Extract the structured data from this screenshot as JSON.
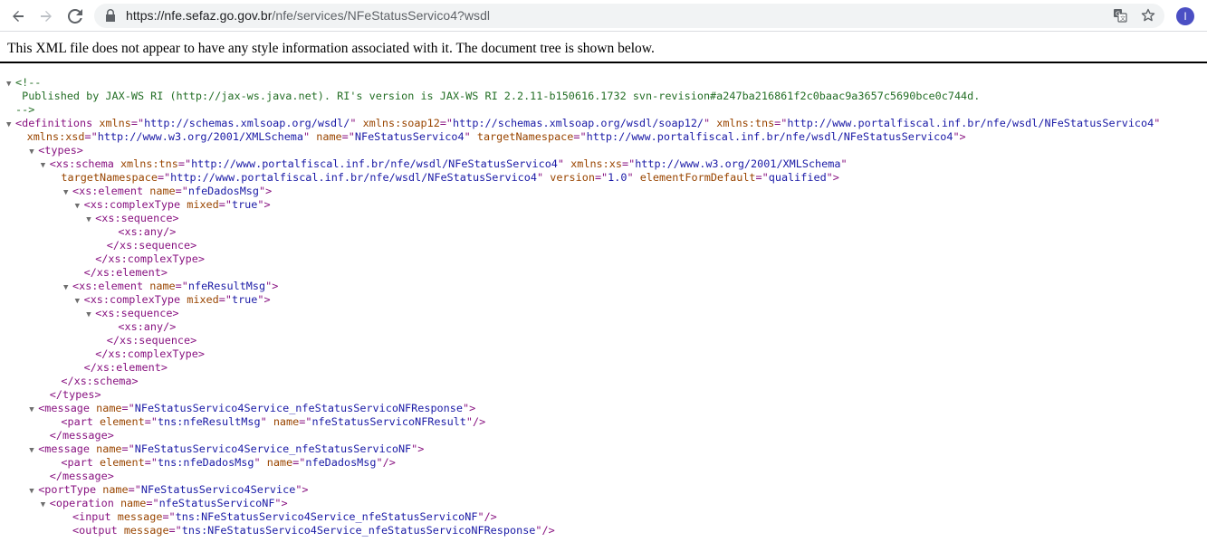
{
  "browser": {
    "url_host": "https://nfe.sefaz.go.gov.br",
    "url_path": "/nfe/services/NFeStatusServico4?wsdl",
    "avatar_letter": "I"
  },
  "info_message": "This XML file does not appear to have any style information associated with it. The document tree is shown below.",
  "xml_lines": [
    {
      "indent": 0,
      "arrow": "▼",
      "parts": [
        [
          "cm",
          "<!--"
        ]
      ]
    },
    {
      "indent": 0,
      "arrow": "",
      "parts": [
        [
          "cm",
          "    Published by JAX-WS RI (http://jax-ws.java.net). RI's version is JAX-WS RI 2.2.11-b150616.1732 svn-revision#a247ba216861f2c0baac9a3657c5690bce0c744d."
        ]
      ]
    },
    {
      "indent": 0,
      "arrow": "",
      "parts": [
        [
          "cm",
          "-->"
        ]
      ]
    },
    {
      "indent": 0,
      "arrow": "▼",
      "parts": [
        [
          "tag",
          "<definitions "
        ],
        [
          "an",
          "xmlns"
        ],
        [
          "tag",
          "=\""
        ],
        [
          "av",
          "http://schemas.xmlsoap.org/wsdl/"
        ],
        [
          "tag",
          "\" "
        ],
        [
          "an",
          "xmlns:soap12"
        ],
        [
          "tag",
          "=\""
        ],
        [
          "av",
          "http://schemas.xmlsoap.org/wsdl/soap12/"
        ],
        [
          "tag",
          "\" "
        ],
        [
          "an",
          "xmlns:tns"
        ],
        [
          "tag",
          "=\""
        ],
        [
          "av",
          "http://www.portalfiscal.inf.br/nfe/wsdl/NFeStatusServico4"
        ],
        [
          "tag",
          "\""
        ]
      ]
    },
    {
      "indent": 1,
      "arrow": "",
      "parts": [
        [
          "an",
          "xmlns:xsd"
        ],
        [
          "tag",
          "=\""
        ],
        [
          "av",
          "http://www.w3.org/2001/XMLSchema"
        ],
        [
          "tag",
          "\" "
        ],
        [
          "an",
          "name"
        ],
        [
          "tag",
          "=\""
        ],
        [
          "av",
          "NFeStatusServico4"
        ],
        [
          "tag",
          "\" "
        ],
        [
          "an",
          "targetNamespace"
        ],
        [
          "tag",
          "=\""
        ],
        [
          "av",
          "http://www.portalfiscal.inf.br/nfe/wsdl/NFeStatusServico4"
        ],
        [
          "tag",
          "\">"
        ]
      ]
    },
    {
      "indent": 2,
      "arrow": "▼",
      "parts": [
        [
          "tag",
          "<types>"
        ]
      ]
    },
    {
      "indent": 3,
      "arrow": "▼",
      "parts": [
        [
          "tag",
          "<xs:schema "
        ],
        [
          "an",
          "xmlns:tns"
        ],
        [
          "tag",
          "=\""
        ],
        [
          "av",
          "http://www.portalfiscal.inf.br/nfe/wsdl/NFeStatusServico4"
        ],
        [
          "tag",
          "\" "
        ],
        [
          "an",
          "xmlns:xs"
        ],
        [
          "tag",
          "=\""
        ],
        [
          "av",
          "http://www.w3.org/2001/XMLSchema"
        ],
        [
          "tag",
          "\""
        ]
      ]
    },
    {
      "indent": 4,
      "arrow": "",
      "parts": [
        [
          "an",
          "targetNamespace"
        ],
        [
          "tag",
          "=\""
        ],
        [
          "av",
          "http://www.portalfiscal.inf.br/nfe/wsdl/NFeStatusServico4"
        ],
        [
          "tag",
          "\" "
        ],
        [
          "an",
          "version"
        ],
        [
          "tag",
          "=\""
        ],
        [
          "av",
          "1.0"
        ],
        [
          "tag",
          "\" "
        ],
        [
          "an",
          "elementFormDefault"
        ],
        [
          "tag",
          "=\""
        ],
        [
          "av",
          "qualified"
        ],
        [
          "tag",
          "\">"
        ]
      ]
    },
    {
      "indent": 5,
      "arrow": "▼",
      "parts": [
        [
          "tag",
          "<xs:element "
        ],
        [
          "an",
          "name"
        ],
        [
          "tag",
          "=\""
        ],
        [
          "av",
          "nfeDadosMsg"
        ],
        [
          "tag",
          "\">"
        ]
      ]
    },
    {
      "indent": 6,
      "arrow": "▼",
      "parts": [
        [
          "tag",
          "<xs:complexType "
        ],
        [
          "an",
          "mixed"
        ],
        [
          "tag",
          "=\""
        ],
        [
          "av",
          "true"
        ],
        [
          "tag",
          "\">"
        ]
      ]
    },
    {
      "indent": 7,
      "arrow": "▼",
      "parts": [
        [
          "tag",
          "<xs:sequence>"
        ]
      ]
    },
    {
      "indent": 9,
      "arrow": "",
      "parts": [
        [
          "tag",
          "<xs:any/>"
        ]
      ]
    },
    {
      "indent": 8,
      "arrow": "",
      "parts": [
        [
          "tag",
          "</xs:sequence>"
        ]
      ]
    },
    {
      "indent": 7,
      "arrow": "",
      "parts": [
        [
          "tag",
          "</xs:complexType>"
        ]
      ]
    },
    {
      "indent": 6,
      "arrow": "",
      "parts": [
        [
          "tag",
          "</xs:element>"
        ]
      ]
    },
    {
      "indent": 5,
      "arrow": "▼",
      "parts": [
        [
          "tag",
          "<xs:element "
        ],
        [
          "an",
          "name"
        ],
        [
          "tag",
          "=\""
        ],
        [
          "av",
          "nfeResultMsg"
        ],
        [
          "tag",
          "\">"
        ]
      ]
    },
    {
      "indent": 6,
      "arrow": "▼",
      "parts": [
        [
          "tag",
          "<xs:complexType "
        ],
        [
          "an",
          "mixed"
        ],
        [
          "tag",
          "=\""
        ],
        [
          "av",
          "true"
        ],
        [
          "tag",
          "\">"
        ]
      ]
    },
    {
      "indent": 7,
      "arrow": "▼",
      "parts": [
        [
          "tag",
          "<xs:sequence>"
        ]
      ]
    },
    {
      "indent": 9,
      "arrow": "",
      "parts": [
        [
          "tag",
          "<xs:any/>"
        ]
      ]
    },
    {
      "indent": 8,
      "arrow": "",
      "parts": [
        [
          "tag",
          "</xs:sequence>"
        ]
      ]
    },
    {
      "indent": 7,
      "arrow": "",
      "parts": [
        [
          "tag",
          "</xs:complexType>"
        ]
      ]
    },
    {
      "indent": 6,
      "arrow": "",
      "parts": [
        [
          "tag",
          "</xs:element>"
        ]
      ]
    },
    {
      "indent": 4,
      "arrow": "",
      "parts": [
        [
          "tag",
          "</xs:schema>"
        ]
      ]
    },
    {
      "indent": 3,
      "arrow": "",
      "parts": [
        [
          "tag",
          "</types>"
        ]
      ]
    },
    {
      "indent": 2,
      "arrow": "▼",
      "parts": [
        [
          "tag",
          "<message "
        ],
        [
          "an",
          "name"
        ],
        [
          "tag",
          "=\""
        ],
        [
          "av",
          "NFeStatusServico4Service_nfeStatusServicoNFResponse"
        ],
        [
          "tag",
          "\">"
        ]
      ]
    },
    {
      "indent": 4,
      "arrow": "",
      "parts": [
        [
          "tag",
          "<part "
        ],
        [
          "an",
          "element"
        ],
        [
          "tag",
          "=\""
        ],
        [
          "av",
          "tns:nfeResultMsg"
        ],
        [
          "tag",
          "\" "
        ],
        [
          "an",
          "name"
        ],
        [
          "tag",
          "=\""
        ],
        [
          "av",
          "nfeStatusServicoNFResult"
        ],
        [
          "tag",
          "\"/>"
        ]
      ]
    },
    {
      "indent": 3,
      "arrow": "",
      "parts": [
        [
          "tag",
          "</message>"
        ]
      ]
    },
    {
      "indent": 2,
      "arrow": "▼",
      "parts": [
        [
          "tag",
          "<message "
        ],
        [
          "an",
          "name"
        ],
        [
          "tag",
          "=\""
        ],
        [
          "av",
          "NFeStatusServico4Service_nfeStatusServicoNF"
        ],
        [
          "tag",
          "\">"
        ]
      ]
    },
    {
      "indent": 4,
      "arrow": "",
      "parts": [
        [
          "tag",
          "<part "
        ],
        [
          "an",
          "element"
        ],
        [
          "tag",
          "=\""
        ],
        [
          "av",
          "tns:nfeDadosMsg"
        ],
        [
          "tag",
          "\" "
        ],
        [
          "an",
          "name"
        ],
        [
          "tag",
          "=\""
        ],
        [
          "av",
          "nfeDadosMsg"
        ],
        [
          "tag",
          "\"/>"
        ]
      ]
    },
    {
      "indent": 3,
      "arrow": "",
      "parts": [
        [
          "tag",
          "</message>"
        ]
      ]
    },
    {
      "indent": 2,
      "arrow": "▼",
      "parts": [
        [
          "tag",
          "<portType "
        ],
        [
          "an",
          "name"
        ],
        [
          "tag",
          "=\""
        ],
        [
          "av",
          "NFeStatusServico4Service"
        ],
        [
          "tag",
          "\">"
        ]
      ]
    },
    {
      "indent": 3,
      "arrow": "▼",
      "parts": [
        [
          "tag",
          "<operation "
        ],
        [
          "an",
          "name"
        ],
        [
          "tag",
          "=\""
        ],
        [
          "av",
          "nfeStatusServicoNF"
        ],
        [
          "tag",
          "\">"
        ]
      ]
    },
    {
      "indent": 5,
      "arrow": "",
      "parts": [
        [
          "tag",
          "<input "
        ],
        [
          "an",
          "message"
        ],
        [
          "tag",
          "=\""
        ],
        [
          "av",
          "tns:NFeStatusServico4Service_nfeStatusServicoNF"
        ],
        [
          "tag",
          "\"/>"
        ]
      ]
    },
    {
      "indent": 5,
      "arrow": "",
      "parts": [
        [
          "tag",
          "<output "
        ],
        [
          "an",
          "message"
        ],
        [
          "tag",
          "=\""
        ],
        [
          "av",
          "tns:NFeStatusServico4Service_nfeStatusServicoNFResponse"
        ],
        [
          "tag",
          "\"/>"
        ]
      ]
    }
  ]
}
